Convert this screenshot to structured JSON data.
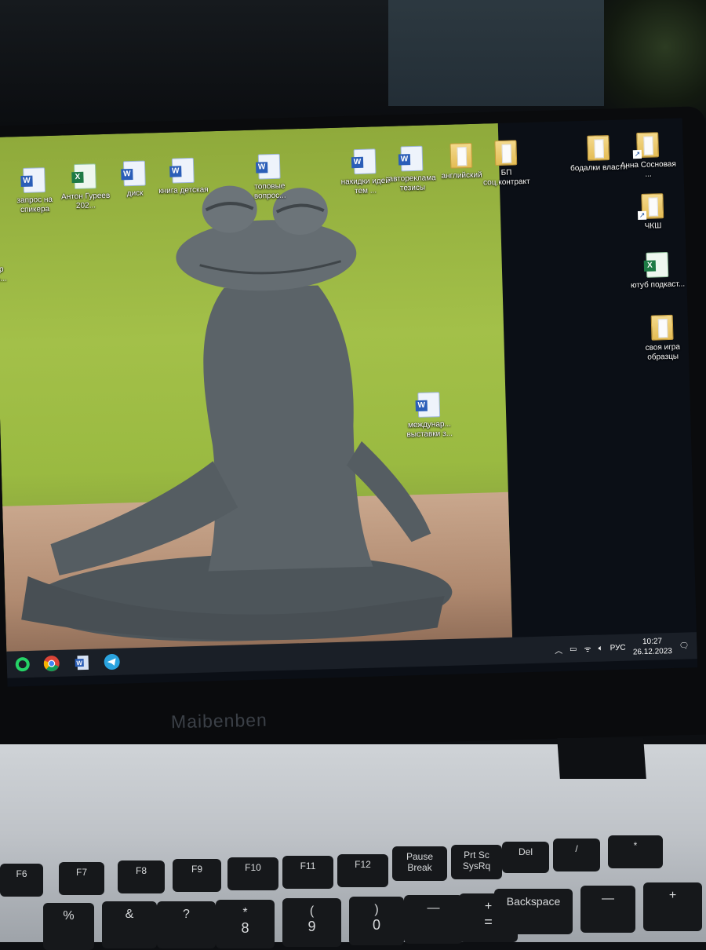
{
  "desktop": {
    "icons": [
      {
        "label": "запрос на спикера",
        "type": "word"
      },
      {
        "label": "Антон Гуреев 202...",
        "type": "excel"
      },
      {
        "label": "диск",
        "type": "word"
      },
      {
        "label": "книга детская",
        "type": "word"
      },
      {
        "label": "топовые вопрос...",
        "type": "word"
      },
      {
        "label": "накидки идей тем ...",
        "type": "word"
      },
      {
        "label": "автореклама тезисы",
        "type": "word"
      },
      {
        "label": "английский",
        "type": "folder"
      },
      {
        "label": "БП соц.контракт",
        "type": "folder"
      },
      {
        "label": "бодалки власти",
        "type": "folder"
      },
      {
        "label": "Анна Сосновая ...",
        "type": "folder-shortcut"
      },
      {
        "label": "ЧКШ",
        "type": "folder-shortcut"
      },
      {
        "label": "ютуб подкаст...",
        "type": "excel"
      },
      {
        "label": "своя игра образцы",
        "type": "folder"
      },
      {
        "label": "междунар... выставки з...",
        "type": "word"
      },
      {
        "label": "р\nь...",
        "type": "partial"
      }
    ]
  },
  "taskbar": {
    "apps": [
      "whatsapp-icon",
      "chrome-icon",
      "word-icon",
      "telegram-icon"
    ],
    "tray": {
      "language": "РУС",
      "time": "10:27",
      "date": "26.12.2023"
    }
  },
  "laptop": {
    "brand": "Maibenben"
  },
  "keyboard": {
    "fn_row": [
      {
        "label": "F6"
      },
      {
        "label": "F7"
      },
      {
        "label": "F8"
      },
      {
        "label": "F9"
      },
      {
        "label": "F10"
      },
      {
        "label": "F11"
      },
      {
        "label": "F12"
      },
      {
        "label": "Pause",
        "sub": "Break"
      },
      {
        "label": "Prt Sc",
        "sub": "SysRq"
      },
      {
        "label": "Del"
      },
      {
        "label": "/"
      },
      {
        "label": "*"
      }
    ],
    "num_row": [
      {
        "label": "%"
      },
      {
        "label": "&"
      },
      {
        "label": "?"
      },
      {
        "label": "*"
      },
      {
        "label": "("
      },
      {
        "label": ")"
      },
      {
        "label": "—"
      },
      {
        "label": "+"
      },
      {
        "label": "Backspace"
      },
      {
        "label": "—"
      },
      {
        "label": "+"
      }
    ],
    "num_row_sub": [
      "8",
      "9",
      "0",
      "="
    ]
  },
  "colors": {
    "taskbar": "#1a1f27",
    "word_blue": "#2b5eb8",
    "excel_green": "#1e7a45",
    "folder_yellow": "#e4bc55"
  }
}
